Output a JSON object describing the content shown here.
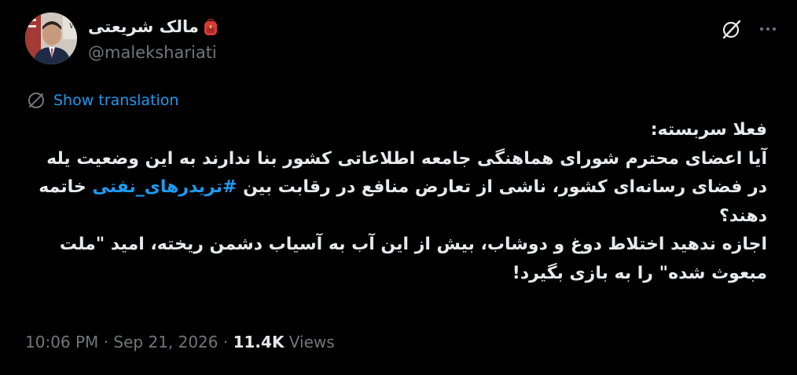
{
  "author": {
    "name": "مالک شریعتی",
    "handle": "@malekshariati",
    "avatar_icon": "profile-photo",
    "badge_icon": "backpack-emoji-icon"
  },
  "actions": {
    "grok_icon": "grok-icon",
    "more_icon": "more-horizontal-icon"
  },
  "translation": {
    "label": "Show translation",
    "icon": "globe-icon"
  },
  "tweet": {
    "line1": "فعلا سربسته:",
    "part2_before_hashtag": "آیا اعضای محترم شورای هماهنگی جامعه اطلاعاتی کشور بنا ندارند به این وضعیت یله در فضای رسانه‌ای کشور، ناشی از تعارض منافع در رقابت بین ",
    "hashtag": "#تریدرهای_نفتی",
    "part2_after_hashtag": " خاتمه دهند؟",
    "part3": "اجازه ندهید اختلاط دوغ و دوشاب، بیش از این آب به آسیاب دشمن ریخته، امید \"ملت مبعوث شده\" را به بازی بگیرد!"
  },
  "meta": {
    "time": "10:06 PM",
    "sep1": " · ",
    "date": "Sep 21, 2026",
    "sep2": " · ",
    "views_count": "11.4K",
    "views_label": " Views"
  },
  "colors": {
    "background": "#000000",
    "text": "#e7e9ea",
    "secondary": "#71767b",
    "accent": "#1d9bf0"
  }
}
